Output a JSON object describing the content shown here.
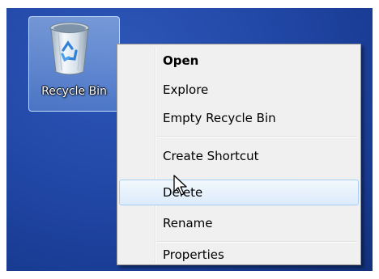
{
  "desktop": {
    "icon": {
      "label": "Recycle Bin",
      "icon_name": "recycle-bin-icon"
    }
  },
  "context_menu": {
    "items": [
      {
        "label": "Open",
        "default": true
      },
      {
        "label": "Explore"
      },
      {
        "label": "Empty Recycle Bin"
      },
      {
        "label": "Create Shortcut"
      },
      {
        "label": "Delete",
        "hovered": true
      },
      {
        "label": "Rename"
      },
      {
        "label": "Properties"
      }
    ]
  },
  "colors": {
    "desktop_background": "#2147a6",
    "menu_background": "#f0f0f0",
    "hover_border": "#a8cdf1"
  },
  "cursor": {
    "icon_name": "arrow-pointer-icon"
  }
}
